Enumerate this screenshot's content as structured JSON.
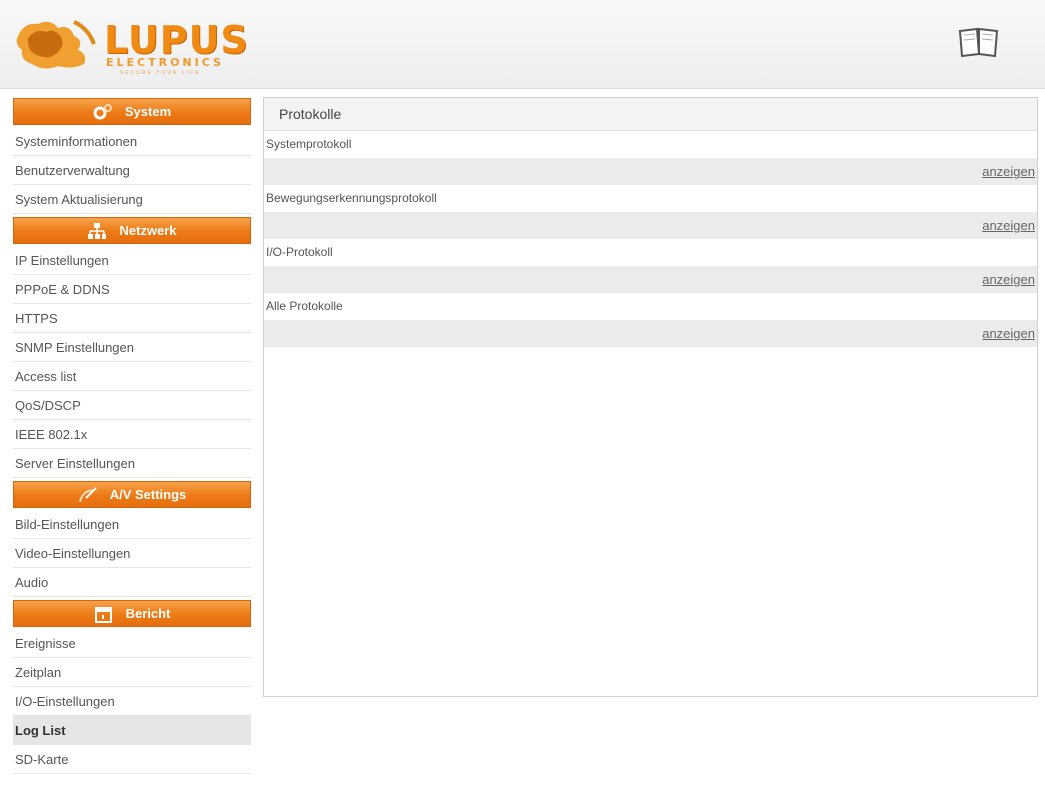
{
  "header": {
    "brand_name": "LUPUS",
    "brand_sub": "ELECTRONICS",
    "brand_tagline": "SECURE YOUR LIFE",
    "icon": "book-icon"
  },
  "sidebar": {
    "sections": [
      {
        "title": "System",
        "icon": "gears-icon",
        "items": [
          "Systeminformationen",
          "Benutzerverwaltung",
          "System Aktualisierung"
        ]
      },
      {
        "title": "Netzwerk",
        "icon": "network-icon",
        "items": [
          "IP Einstellungen",
          "PPPoE & DDNS",
          "HTTPS",
          "SNMP Einstellungen",
          "Access list",
          "QoS/DSCP",
          "IEEE 802.1x",
          "Server Einstellungen"
        ]
      },
      {
        "title": "A/V Settings",
        "icon": "satellite-icon",
        "items": [
          "Bild-Einstellungen",
          "Video-Einstellungen",
          "Audio"
        ]
      },
      {
        "title": "Bericht",
        "icon": "calendar-icon",
        "items": [
          "Ereignisse",
          "Zeitplan",
          "I/O-Einstellungen",
          "Log List",
          "SD-Karte"
        ]
      }
    ],
    "active_item": "Log List"
  },
  "main": {
    "title": "Protokolle",
    "logs": [
      {
        "label": "Systemprotokoll",
        "link": "anzeigen"
      },
      {
        "label": "Bewegungserkennungsprotokoll",
        "link": "anzeigen"
      },
      {
        "label": "I/O-Protokoll",
        "link": "anzeigen"
      },
      {
        "label": "Alle Protokolle",
        "link": "anzeigen"
      }
    ]
  },
  "colors": {
    "accent": "#ec7a16",
    "brand": "#f08a12"
  }
}
